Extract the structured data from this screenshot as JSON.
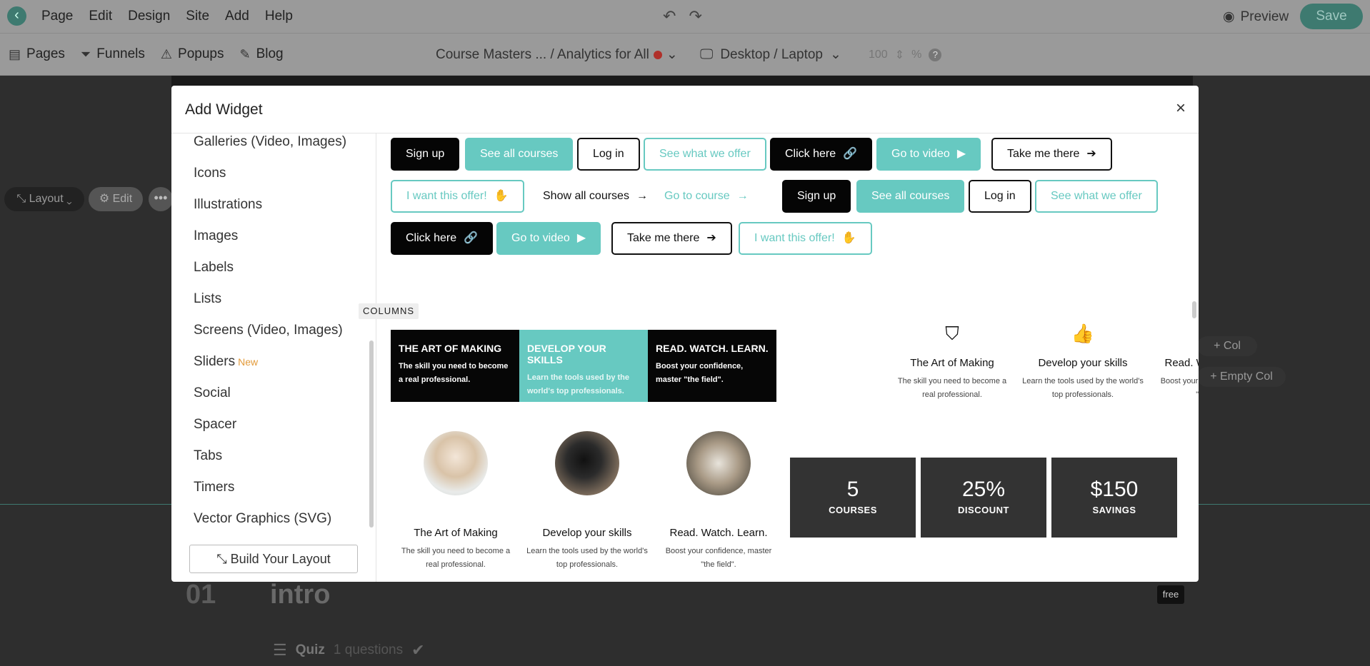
{
  "topbar": {
    "menu": [
      "Page",
      "Edit",
      "Design",
      "Site",
      "Add",
      "Help"
    ],
    "preview_label": "Preview",
    "save_label": "Save"
  },
  "subbar": {
    "nav": [
      {
        "label": "Pages",
        "icon": "page-icon"
      },
      {
        "label": "Funnels",
        "icon": "funnel-icon"
      },
      {
        "label": "Popups",
        "icon": "popup-icon"
      },
      {
        "label": "Blog",
        "icon": "blog-icon"
      }
    ],
    "site_select": "Course Masters ... / Analytics for All",
    "device_select": "Desktop / Laptop",
    "zoom_value": "100",
    "zoom_unit": "%",
    "help": "?"
  },
  "canvas": {
    "layout_label": "Layout",
    "edit_label": "Edit",
    "more_label": "•••",
    "col_label": "+ Col",
    "empty_col_label": "+ Empty Col",
    "lesson_number": "01",
    "lesson_title": "intro",
    "free_label": "free",
    "quiz_label": "Quiz",
    "quiz_count": "1 questions"
  },
  "modal": {
    "title": "Add Widget",
    "close": "×",
    "sidebar_items": [
      {
        "label": "Galleries (Video, Images)"
      },
      {
        "label": "Icons"
      },
      {
        "label": "Illustrations"
      },
      {
        "label": "Images"
      },
      {
        "label": "Labels"
      },
      {
        "label": "Lists"
      },
      {
        "label": "Screens (Video, Images)"
      },
      {
        "label": "Sliders",
        "badge": "New"
      },
      {
        "label": "Social"
      },
      {
        "label": "Spacer"
      },
      {
        "label": "Tabs"
      },
      {
        "label": "Timers"
      },
      {
        "label": "Vector Graphics (SVG)"
      }
    ],
    "build_layout_label": "Build Your Layout",
    "buttons": [
      "Sign up",
      "See all courses",
      "Log in",
      "See what we offer",
      "Click here",
      "Go to video",
      "Take me there",
      "I want this offer!",
      "Show all courses",
      "Go to course",
      "Sign up",
      "See all courses",
      "Log in",
      "See what we offer",
      "Click here",
      "Go to video",
      "Take me there",
      "I want this offer!"
    ],
    "section_columns": "COLUMNS",
    "columns_cards": [
      {
        "title": "THE ART OF MAKING",
        "text": "The skill you need to become a real professional."
      },
      {
        "title": "DEVELOP YOUR SKILLS",
        "text": "Learn the tools used by the world's top professionals."
      },
      {
        "title": "READ. WATCH. LEARN.",
        "text": "Boost your confidence, master \"the field\"."
      }
    ],
    "icon_columns": [
      {
        "icon": "shield-icon",
        "title": "The Art of Making",
        "text": "The skill you need to become a real professional."
      },
      {
        "icon": "thumbs-up-icon",
        "title": "Develop your skills",
        "text": "Learn the tools used by the world's top professionals."
      },
      {
        "icon": "calendar-check-icon",
        "title": "Read. Watch. Learn.",
        "text": "Boost your confidence, master \"the field\"."
      }
    ],
    "image_columns": [
      {
        "title": "The Art of Making",
        "text": "The skill you need to become a real professional."
      },
      {
        "title": "Develop your skills",
        "text": "Learn the tools used by the world's top professionals."
      },
      {
        "title": "Read. Watch. Learn.",
        "text": "Boost your confidence, master \"the field\"."
      }
    ],
    "stats": [
      {
        "num": "5",
        "label": "COURSES"
      },
      {
        "num": "25%",
        "label": "DISCOUNT"
      },
      {
        "num": "$150",
        "label": "SAVINGS"
      }
    ]
  },
  "colors": {
    "teal": "#67c9c1",
    "dark_teal": "#3e7a70",
    "black": "#050505",
    "stat_bg": "#333333"
  }
}
